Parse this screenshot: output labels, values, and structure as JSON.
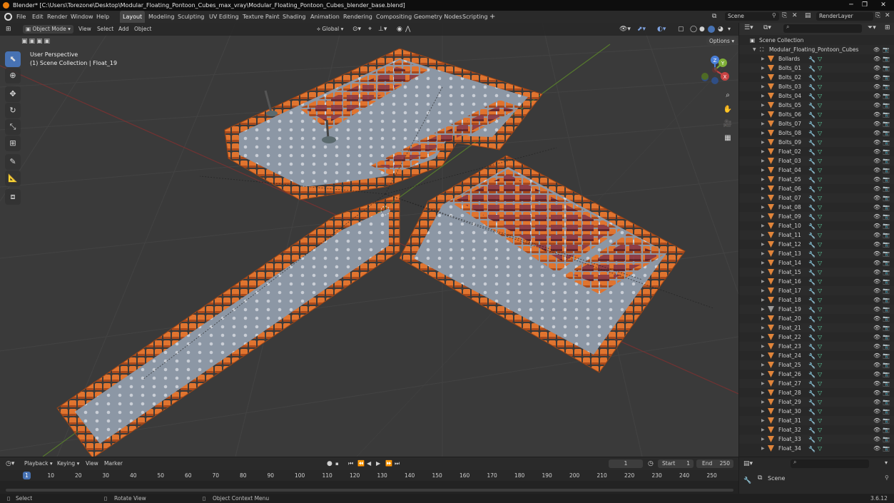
{
  "window": {
    "title": "Blender* [C:\\Users\\Torezone\\Desktop\\Modular_Floating_Pontoon_Cubes_max_vray\\Modular_Floating_Pontoon_Cubes_blender_base.blend]",
    "min": "─",
    "max": "❐",
    "close": "✕"
  },
  "menu": [
    "File",
    "Edit",
    "Render",
    "Window",
    "Help"
  ],
  "workspaces": [
    "Layout",
    "Modeling",
    "Sculpting",
    "UV Editing",
    "Texture Paint",
    "Shading",
    "Animation",
    "Rendering",
    "Compositing",
    "Geometry Nodes",
    "Scripting",
    "+"
  ],
  "scene": {
    "name": "Scene",
    "render_layer": "RenderLayer"
  },
  "viewport": {
    "mode": "Object Mode",
    "menus": [
      "View",
      "Select",
      "Add",
      "Object"
    ],
    "orientation": "Global",
    "options": "Options",
    "overlay_title": "User Perspective",
    "overlay_sub": "(1) Scene Collection | Float_19"
  },
  "gizmo": {
    "x": "X",
    "y": "Y",
    "z": "Z"
  },
  "outliner": {
    "search_placeholder": "",
    "root": "Scene Collection",
    "collection": "Modular_Floating_Pontoon_Cubes",
    "items": [
      "Bollards",
      "Bolts_01",
      "Bolts_02",
      "Bolts_03",
      "Bolts_04",
      "Bolts_05",
      "Bolts_06",
      "Bolts_07",
      "Bolts_08",
      "Bolts_09",
      "Float_02",
      "Float_03",
      "Float_04",
      "Float_05",
      "Float_06",
      "Float_07",
      "Float_08",
      "Float_09",
      "Float_10",
      "Float_11",
      "Float_12",
      "Float_13",
      "Float_14",
      "Float_15",
      "Float_16",
      "Float_17",
      "Float_18",
      "Float_19",
      "Float_20",
      "Float_21",
      "Float_22",
      "Float_23",
      "Float_24",
      "Float_25",
      "Float_26",
      "Float_27",
      "Float_28",
      "Float_29",
      "Float_30",
      "Float_31",
      "Float_32",
      "Float_33",
      "Float_34"
    ],
    "selected": "Float_19"
  },
  "timeline": {
    "menus": [
      "Playback",
      "Keying",
      "View",
      "Marker"
    ],
    "current_frame": "1",
    "start_label": "Start",
    "start": "1",
    "end_label": "End",
    "end": "250",
    "ticks": [
      "1",
      "10",
      "20",
      "30",
      "40",
      "50",
      "60",
      "70",
      "80",
      "90",
      "100",
      "110",
      "120",
      "130",
      "140",
      "150",
      "160",
      "170",
      "180",
      "190",
      "200",
      "210",
      "220",
      "230",
      "240",
      "250"
    ]
  },
  "properties": {
    "scene": "Scene"
  },
  "status": {
    "select": "Select",
    "rotate": "Rotate View",
    "context": "Object Context Menu",
    "version": "3.6.12"
  },
  "colors": {
    "accent": "#4772b3",
    "float_orange": "#d8682e",
    "deck": "#8a95a3",
    "x_axis": "#c94343",
    "y_axis": "#7fae38",
    "z_axis": "#4a7fd8"
  }
}
